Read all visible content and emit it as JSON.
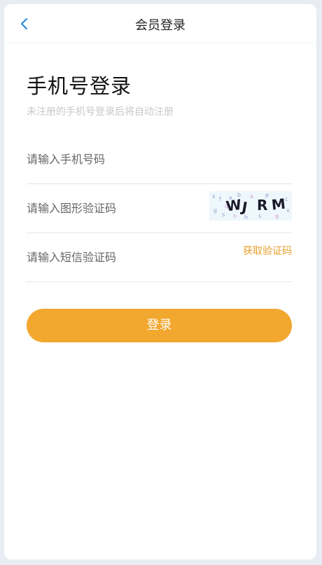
{
  "header": {
    "title": "会员登录"
  },
  "main": {
    "heading": "手机号登录",
    "subtitle": "未注册的手机号登录后将自动注册"
  },
  "fields": {
    "phone": {
      "placeholder": "请输入手机号码"
    },
    "captcha": {
      "placeholder": "请输入图形验证码"
    },
    "sms": {
      "placeholder": "请输入短信验证码"
    }
  },
  "captcha_image": {
    "text": "WJRM"
  },
  "sms_button": "获取验证码",
  "login_button": "登录",
  "colors": {
    "accent": "#f2a72f",
    "link": "#e59f2c",
    "back_arrow": "#2a8be0"
  }
}
